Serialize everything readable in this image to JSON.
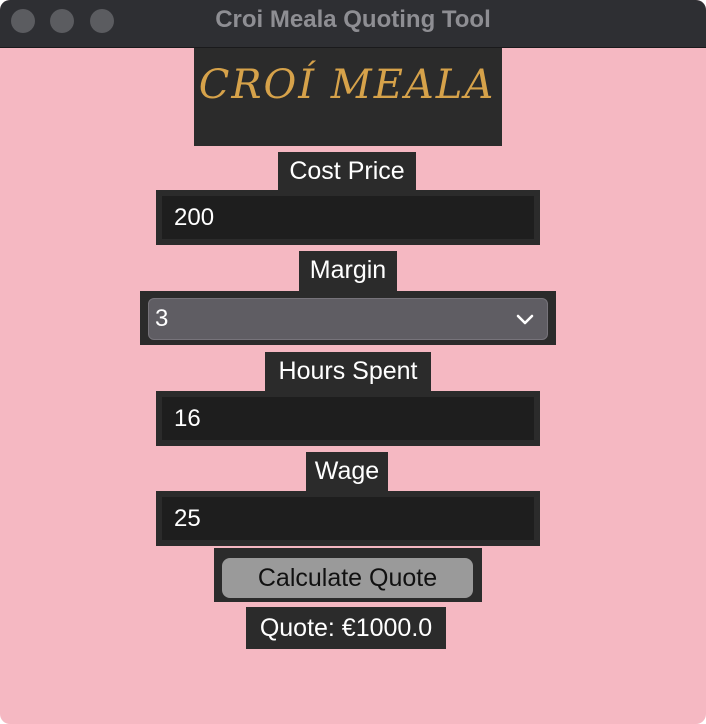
{
  "window": {
    "title": "Croi Meala Quoting Tool"
  },
  "logo": {
    "text": "CROI MEALA"
  },
  "form": {
    "cost_price": {
      "label": "Cost Price",
      "value": "200"
    },
    "margin": {
      "label": "Margin",
      "selected": "3"
    },
    "hours_spent": {
      "label": "Hours Spent",
      "value": "16"
    },
    "wage": {
      "label": "Wage",
      "value": "25"
    },
    "calculate_button": "Calculate Quote",
    "quote_text": "Quote: €1000.0"
  },
  "colors": {
    "background": "#f5b8c2",
    "panel": "#2b2b2b",
    "input": "#1e1e1e",
    "logo": "#d6a24a"
  }
}
